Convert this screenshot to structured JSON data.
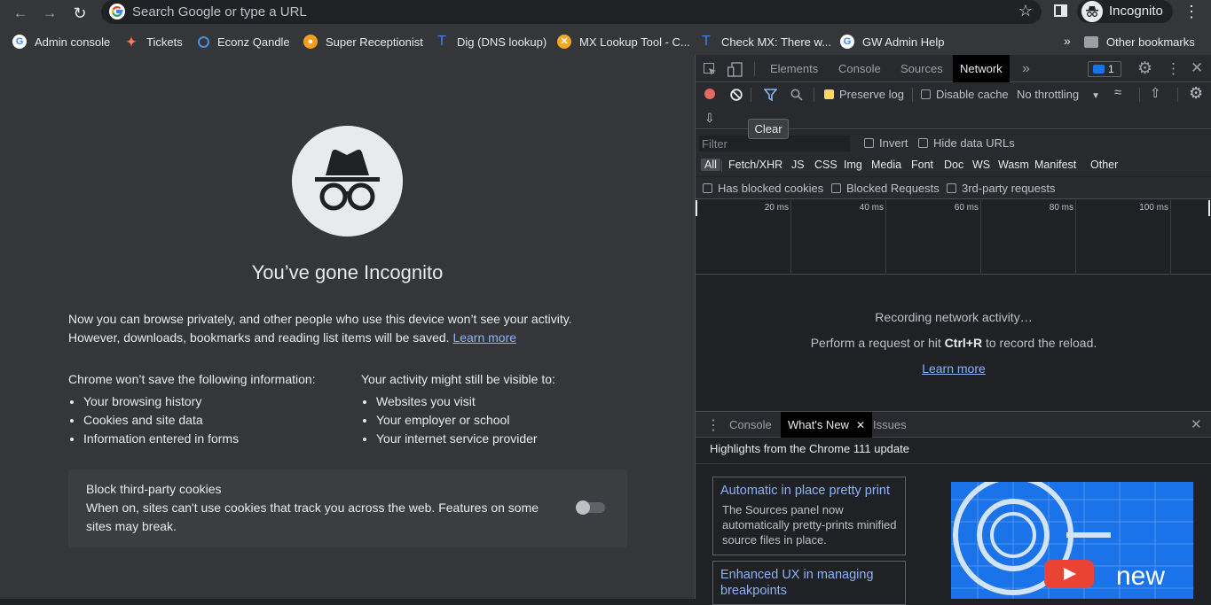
{
  "browser": {
    "omnibox_placeholder": "Search Google or type a URL",
    "profile_label": "Incognito"
  },
  "bookmarks": [
    {
      "label": "Admin console",
      "icon": "google-icon"
    },
    {
      "label": "Tickets",
      "icon": "hubspot-icon"
    },
    {
      "label": "Econz Qandle",
      "icon": "qandle-icon"
    },
    {
      "label": "Super Receptionist",
      "icon": "super-receptionist-icon"
    },
    {
      "label": "Dig (DNS lookup)",
      "icon": "t-icon"
    },
    {
      "label": "MX Lookup Tool - C...",
      "icon": "mxtoolbox-icon"
    },
    {
      "label": "Check MX: There w...",
      "icon": "t-icon"
    },
    {
      "label": "GW Admin Help",
      "icon": "google-icon"
    }
  ],
  "bookmarks_overflow": "»",
  "other_bookmarks": "Other bookmarks",
  "ntp": {
    "title": "You’ve gone Incognito",
    "intro": "Now you can browse privately, and other people who use this device won’t see your activity. However, downloads, bookmarks and reading list items will be saved.",
    "learn_more": "Learn more",
    "left_heading": "Chrome won’t save the following information:",
    "left_items": [
      "Your browsing history",
      "Cookies and site data",
      "Information entered in forms"
    ],
    "right_heading": "Your activity might still be visible to:",
    "right_items": [
      "Websites you visit",
      "Your employer or school",
      "Your internet service provider"
    ],
    "cookie_title": "Block third-party cookies",
    "cookie_desc": "When on, sites can't use cookies that track you across the web. Features on some sites may break.",
    "cookie_toggle_on": false
  },
  "devtools": {
    "tabs": [
      "Elements",
      "Console",
      "Sources",
      "Network"
    ],
    "active_tab": "Network",
    "overflow": "»",
    "issues_count": "1",
    "preserve_log": "Preserve log",
    "disable_cache": "Disable cache",
    "throttling": "No throttling",
    "tooltip": "Clear",
    "filter_placeholder": "Filter",
    "invert": "Invert",
    "hide_data_urls": "Hide data URLs",
    "types": [
      "All",
      "Fetch/XHR",
      "JS",
      "CSS",
      "Img",
      "Media",
      "Font",
      "Doc",
      "WS",
      "Wasm",
      "Manifest",
      "Other"
    ],
    "has_blocked_cookies": "Has blocked cookies",
    "blocked_requests": "Blocked Requests",
    "third_party": "3rd-party requests",
    "ticks": [
      "20 ms",
      "40 ms",
      "60 ms",
      "80 ms",
      "100 ms"
    ],
    "recording_line1": "Recording network activity…",
    "recording_line2_pre": "Perform a request or hit ",
    "recording_line2_key": "Ctrl+R",
    "recording_line2_post": " to record the reload.",
    "recording_learn_more": "Learn more",
    "drawer_tabs": [
      "Console",
      "What's New",
      "Issues"
    ],
    "whatsnew_heading": "Highlights from the Chrome 111 update",
    "card1_title": "Automatic in place pretty print",
    "card1_desc": "The Sources panel now automatically pretty-prints minified source files in place.",
    "card2_title": "Enhanced UX in managing breakpoints",
    "promo_text": "new"
  }
}
